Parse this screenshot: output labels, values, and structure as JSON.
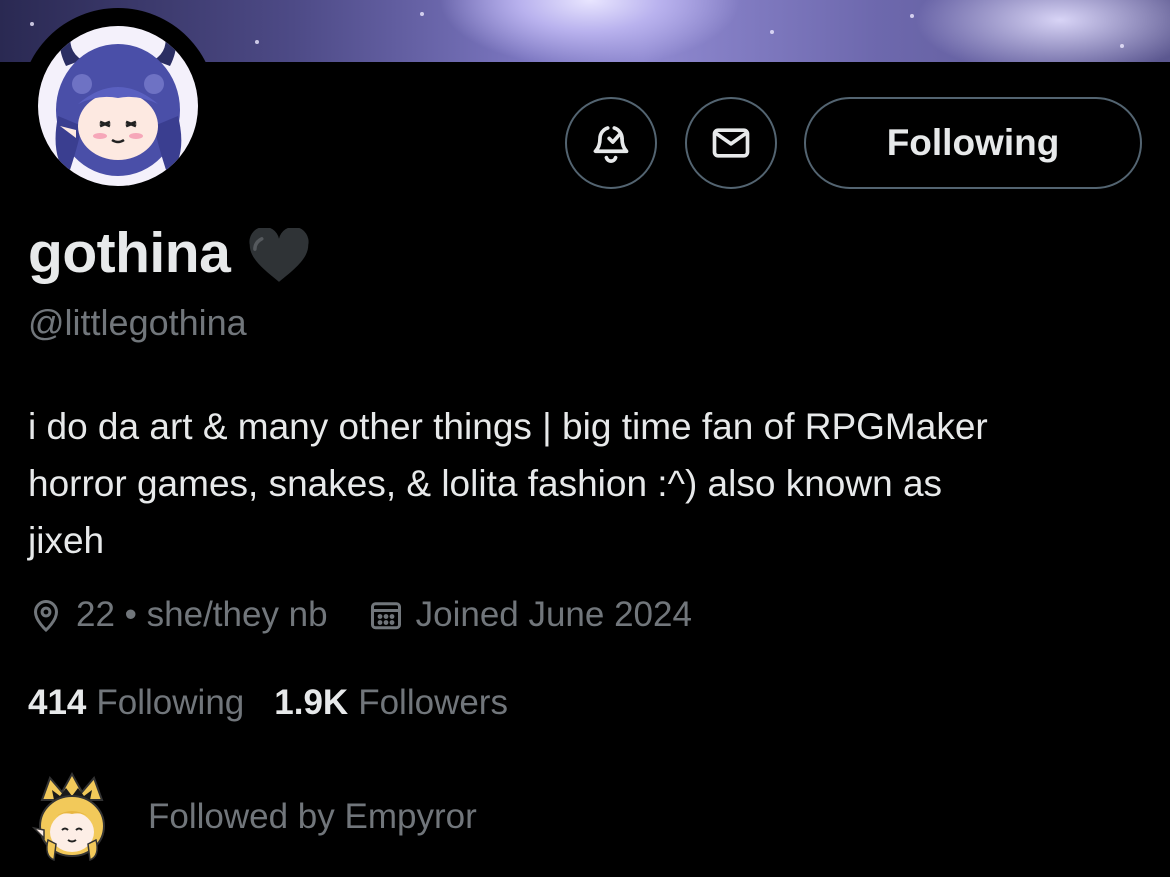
{
  "profile": {
    "display_name": "gothina",
    "name_emoji": "black-heart",
    "handle": "@littlegothina",
    "bio_lines": [
      "i do da art & many other things | big time fan of RPGMaker",
      "horror games, snakes, & lolita fashion :^) also known as",
      "jixeh"
    ],
    "location": "22 • she/they nb",
    "joined": "Joined June 2024"
  },
  "stats": {
    "following_count": "414",
    "following_label": "Following",
    "followers_count": "1.9K",
    "followers_label": "Followers"
  },
  "actions": {
    "notify_icon": "bell-check-icon",
    "message_icon": "envelope-icon",
    "follow_state_label": "Following"
  },
  "followed_by": {
    "text": "Followed by Empyror"
  },
  "colors": {
    "background": "#000000",
    "primary_text": "#e7e9ea",
    "secondary_text": "#71767b",
    "button_border": "#536471",
    "avatar_hair": "#4a4fa8",
    "follower_hair": "#f2c95a"
  }
}
